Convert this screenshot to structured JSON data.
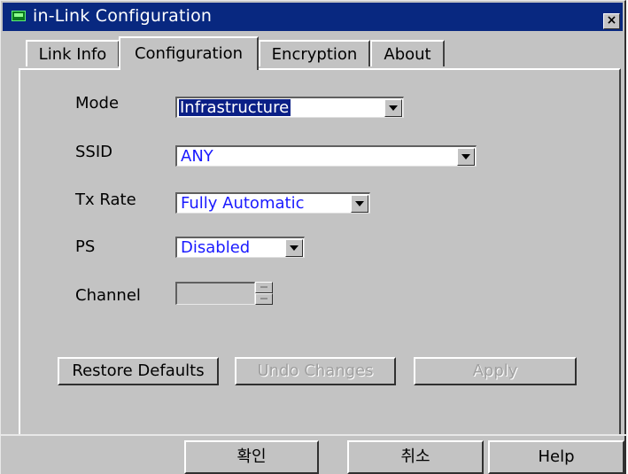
{
  "window": {
    "title": "in-Link Configuration",
    "close_label": "×"
  },
  "tabs": [
    {
      "label": "Link Info",
      "active": false
    },
    {
      "label": "Configuration",
      "active": true
    },
    {
      "label": "Encryption",
      "active": false
    },
    {
      "label": "About",
      "active": false
    }
  ],
  "form": {
    "mode": {
      "label": "Mode",
      "value": "Infrastructure"
    },
    "ssid": {
      "label": "SSID",
      "value": "ANY"
    },
    "tx_rate": {
      "label": "Tx Rate",
      "value": "Fully Automatic"
    },
    "ps": {
      "label": "PS",
      "value": "Disabled"
    },
    "channel": {
      "label": "Channel",
      "value": ""
    }
  },
  "panel_buttons": {
    "restore": "Restore Defaults",
    "undo": "Undo Changes",
    "apply": "Apply"
  },
  "dialog_buttons": {
    "ok": "확인",
    "cancel": "취소",
    "help": "Help"
  },
  "colors": {
    "title_bar": "#082880",
    "selection": "#0a1f86",
    "value_text": "#1a1aff",
    "face": "#c3c3c3"
  }
}
